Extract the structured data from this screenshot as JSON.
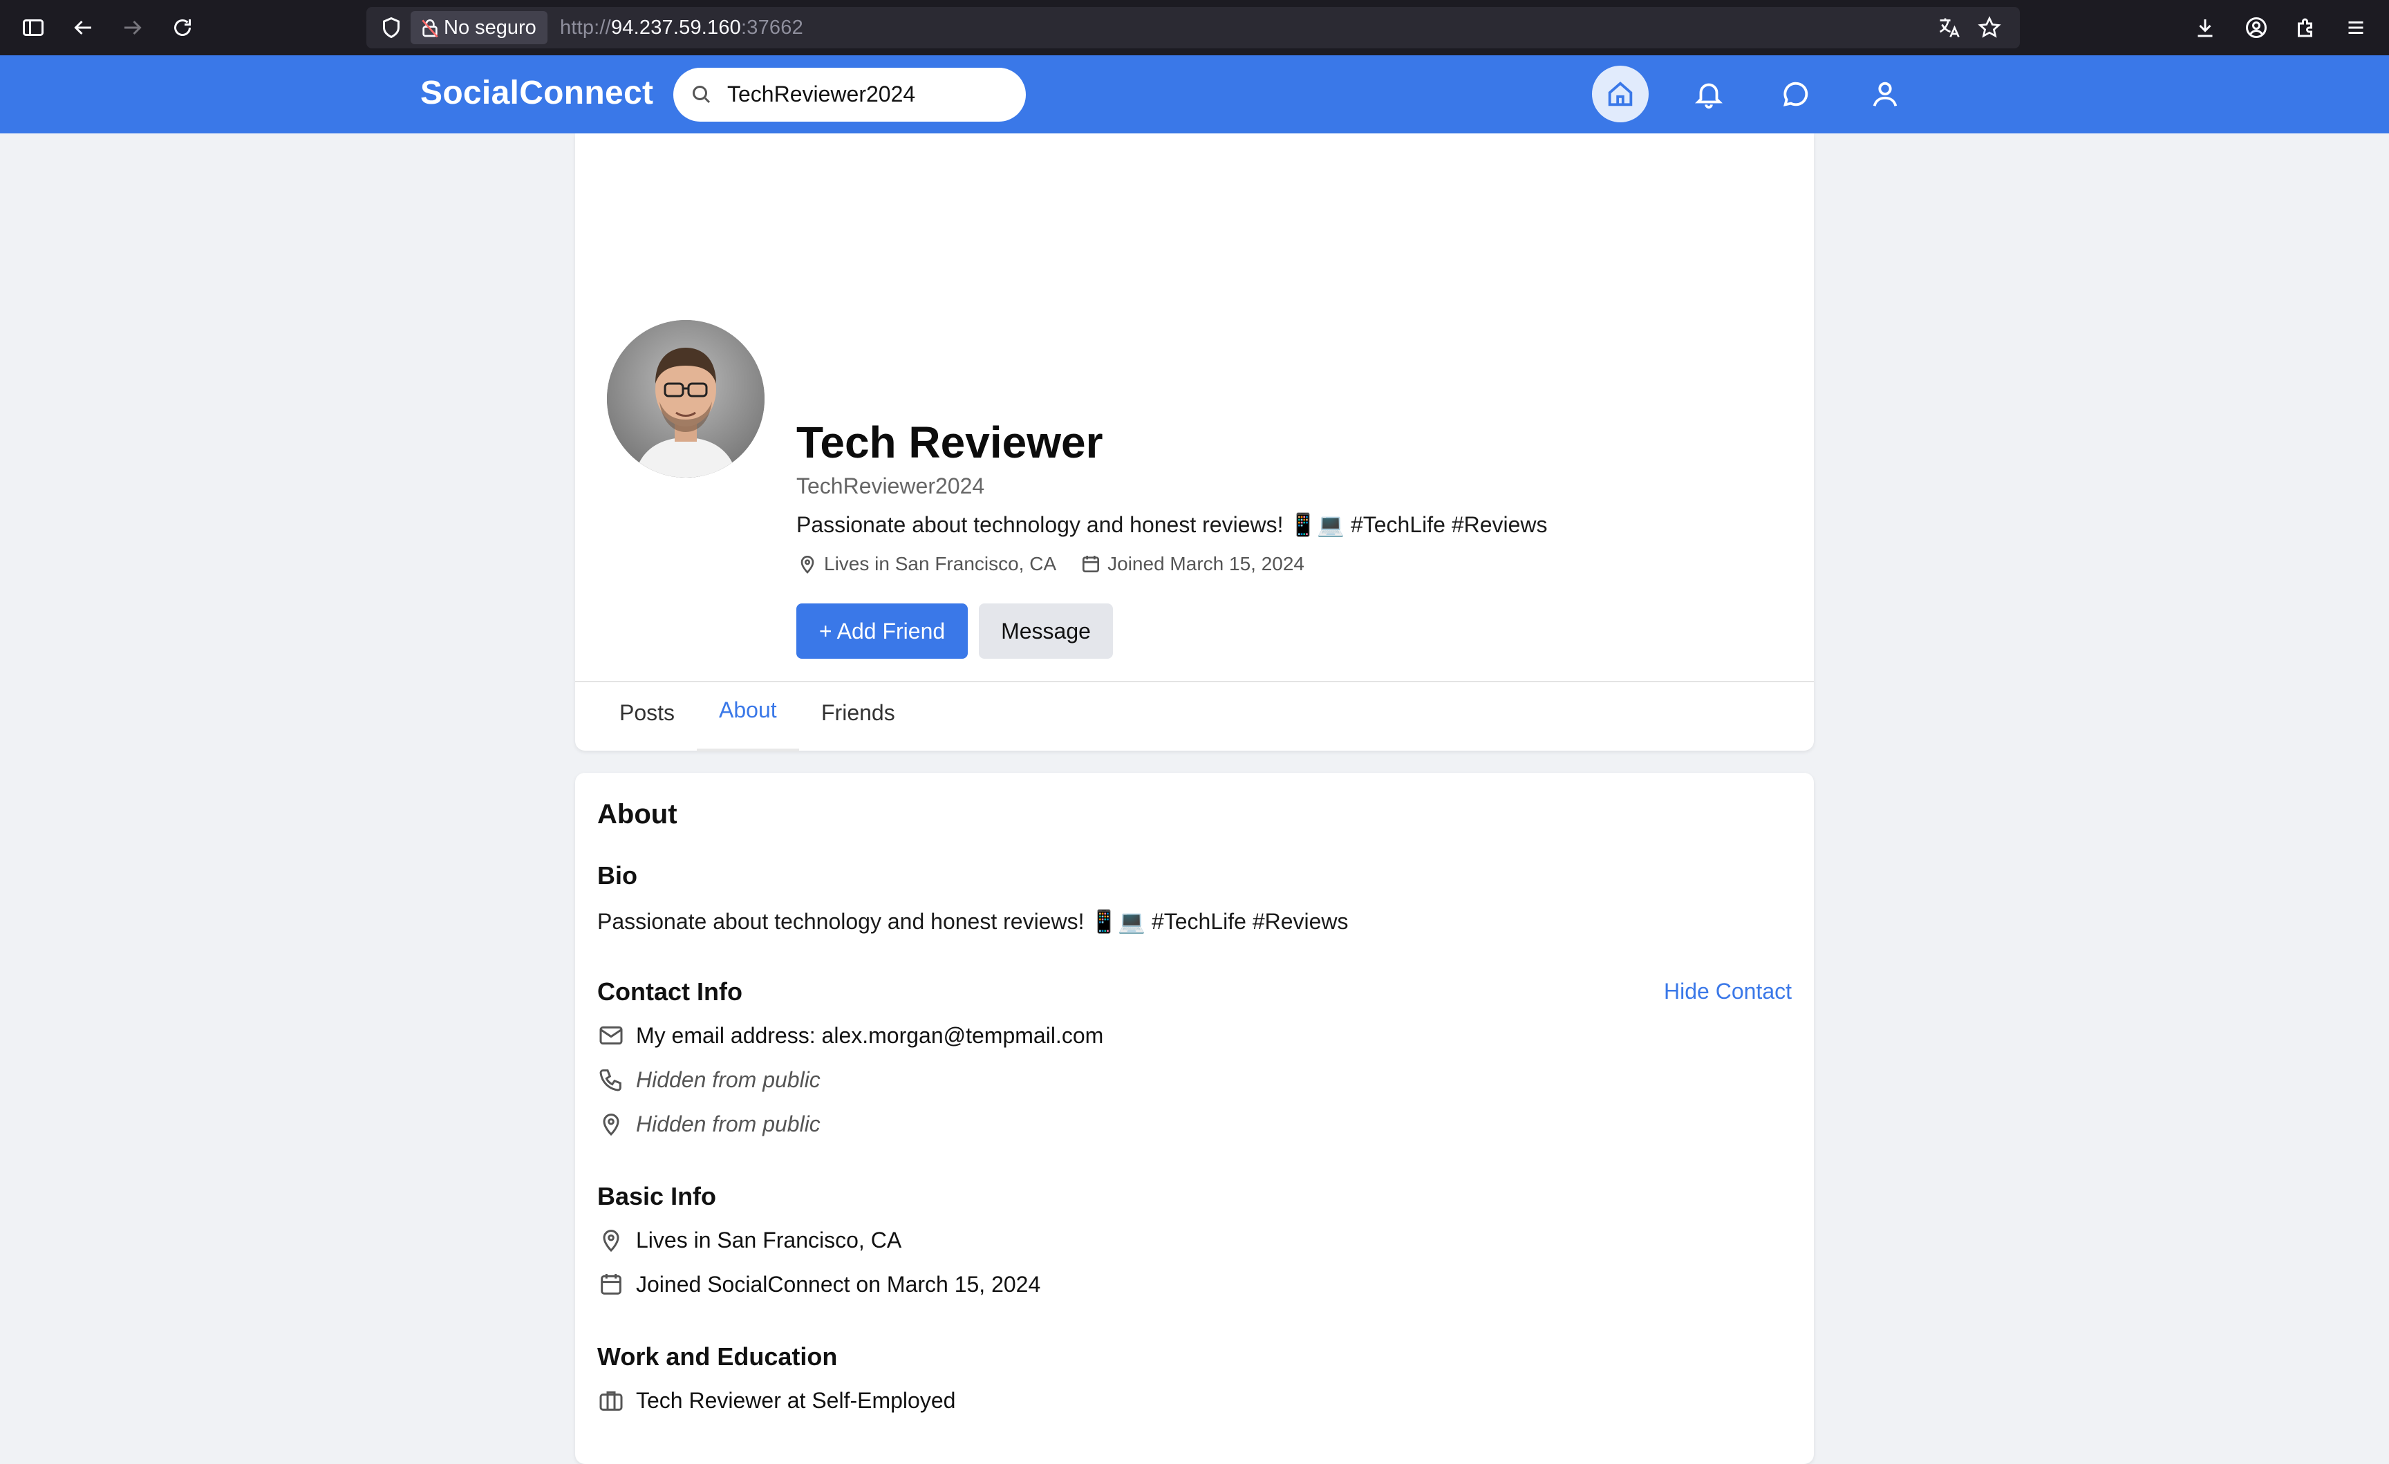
{
  "browser": {
    "security_label": "No seguro",
    "url_prefix": "http://",
    "url_host": "94.237.59.160",
    "url_port": ":37662"
  },
  "header": {
    "brand": "SocialConnect",
    "search_value": "TechReviewer2024",
    "nav": [
      "home-icon",
      "bell-icon",
      "chat-icon",
      "user-icon"
    ],
    "accent_color": "#3a78e8"
  },
  "profile": {
    "name": "Tech Reviewer",
    "handle": "TechReviewer2024",
    "bio": "Passionate about technology and honest reviews! 📱💻 #TechLife #Reviews",
    "location": "Lives in San Francisco, CA",
    "joined": "Joined March 15, 2024",
    "add_friend_label": "+ Add Friend",
    "message_label": "Message"
  },
  "tabs": [
    {
      "label": "Posts",
      "active": false
    },
    {
      "label": "About",
      "active": true
    },
    {
      "label": "Friends",
      "active": false
    }
  ],
  "about": {
    "title": "About",
    "bio_heading": "Bio",
    "bio_text": "Passionate about technology and honest reviews! 📱💻 #TechLife #Reviews",
    "contact_heading": "Contact Info",
    "hide_contact_label": "Hide Contact",
    "email_text": "My email address: alex.morgan@tempmail.com",
    "phone_text": "Hidden from public",
    "address_text": "Hidden from public",
    "basic_heading": "Basic Info",
    "basic_location": "Lives in San Francisco, CA",
    "basic_joined": "Joined SocialConnect on March 15, 2024",
    "work_heading": "Work and Education",
    "work_text": "Tech Reviewer at Self-Employed"
  }
}
